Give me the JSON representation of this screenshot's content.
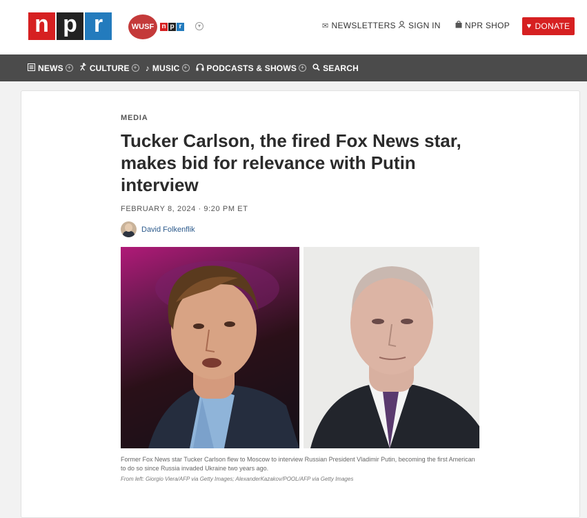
{
  "header": {
    "logo_letters": [
      "n",
      "p",
      "r"
    ],
    "station": {
      "name": "WUSF",
      "mini_letters": [
        "n",
        "p",
        "r"
      ]
    },
    "links": {
      "newsletters": "NEWSLETTERS",
      "sign_in": "SIGN IN",
      "shop": "NPR SHOP",
      "donate": "DONATE"
    }
  },
  "nav": {
    "items": [
      {
        "label": "NEWS",
        "icon": "news-icon"
      },
      {
        "label": "CULTURE",
        "icon": "culture-icon"
      },
      {
        "label": "MUSIC",
        "icon": "music-note-icon"
      },
      {
        "label": "PODCASTS & SHOWS",
        "icon": "headphones-icon"
      },
      {
        "label": "SEARCH",
        "icon": "search-icon"
      }
    ]
  },
  "article": {
    "slug": "MEDIA",
    "headline": "Tucker Carlson, the fired Fox News star, makes bid for relevance with Putin interview",
    "dateline": "FEBRUARY 8, 2024 · 9:20 PM ET",
    "author": "David Folkenflik",
    "caption": "Former Fox News star Tucker Carlson flew to Moscow to interview Russian President Vladimir Putin, becoming the first American to do so since Russia invaded Ukraine two years ago.",
    "credit": "From left: Giorgio Viera/AFP via Getty Images; AlexanderKazakov/POOL/AFP via Getty Images"
  },
  "colors": {
    "npr_red": "#d62021",
    "npr_black": "#222222",
    "npr_blue": "#237bbd",
    "nav_bg": "#4b4b4b",
    "link_blue": "#2c5a8c"
  }
}
